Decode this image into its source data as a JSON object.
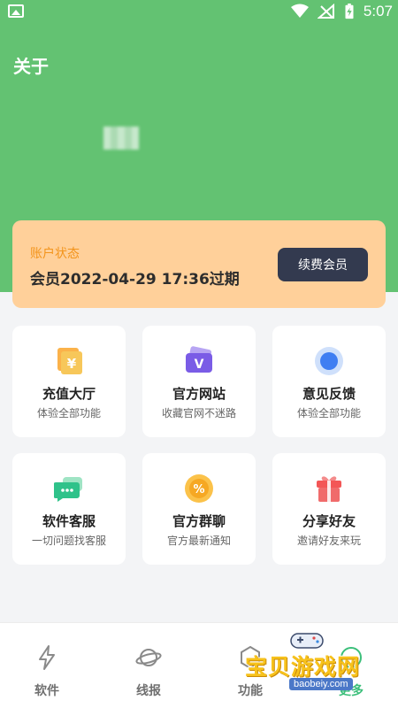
{
  "status_bar": {
    "time": "5:07"
  },
  "header": {
    "title": "关于"
  },
  "account": {
    "label": "账户状态",
    "value": "会员2022-04-29 17:36过期",
    "renew_label": "续费会员"
  },
  "features": [
    {
      "title": "充值大厅",
      "subtitle": "体验全部功能",
      "icon": "yen-wallet-icon"
    },
    {
      "title": "官方网站",
      "subtitle": "收藏官网不迷路",
      "icon": "website-v-icon"
    },
    {
      "title": "意见反馈",
      "subtitle": "体验全部功能",
      "icon": "feedback-circle-icon"
    },
    {
      "title": "软件客服",
      "subtitle": "一切问题找客服",
      "icon": "chat-bubble-icon"
    },
    {
      "title": "官方群聊",
      "subtitle": "官方最新通知",
      "icon": "percent-badge-icon"
    },
    {
      "title": "分享好友",
      "subtitle": "邀请好友来玩",
      "icon": "gift-icon"
    }
  ],
  "bottom_nav": [
    {
      "label": "软件",
      "icon": "lightning-icon"
    },
    {
      "label": "线报",
      "icon": "planet-icon"
    },
    {
      "label": "功能",
      "icon": "hexagon-icon"
    },
    {
      "label": "更多",
      "icon": "more-icon"
    }
  ],
  "watermark": {
    "text": "宝贝游戏网",
    "url": "baobeiy.com"
  },
  "colors": {
    "header_green": "#63c272",
    "account_card": "#ffd09a",
    "account_label": "#f3941b",
    "renew_button": "#333a4f"
  }
}
